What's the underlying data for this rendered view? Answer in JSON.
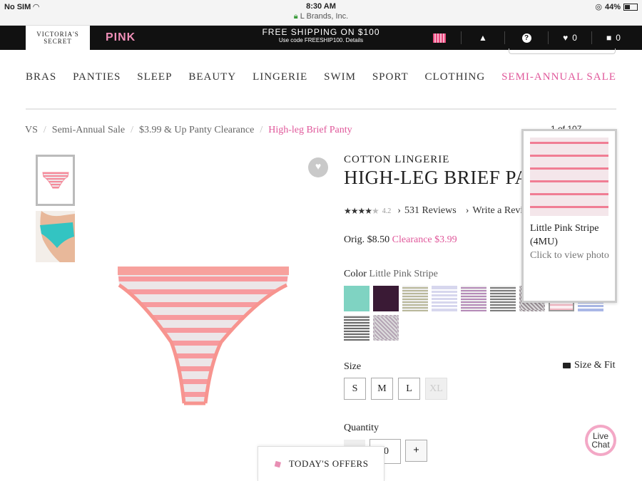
{
  "status_bar": {
    "carrier": "No SIM",
    "time": "8:30 AM",
    "site": "L Brands, Inc.",
    "battery": "44%"
  },
  "top_bar": {
    "brand_vs_line1": "VICTORIA'S",
    "brand_vs_line2": "SECRET",
    "brand_pink": "PINK",
    "shipping_line1": "FREE SHIPPING ON $100",
    "shipping_line2": "Use code FREESHIP100. Details",
    "favorites_count": "0",
    "bag_count": "0"
  },
  "nav": {
    "items": [
      "BRAS",
      "PANTIES",
      "SLEEP",
      "BEAUTY",
      "LINGERIE",
      "SWIM",
      "SPORT",
      "CLOTHING",
      "SEMI-ANNUAL SALE"
    ]
  },
  "breadcrumb": [
    "VS",
    "Semi-Annual Sale",
    "$3.99 & Up Panty Clearance",
    "High-leg Brief Panty"
  ],
  "product": {
    "collection": "COTTON LINGERIE",
    "title": "HIGH-LEG BRIEF PANTY",
    "rating_value": "4.2",
    "reviews_link": "531 Reviews",
    "write_link": "Write a Review",
    "orig_price": "Orig. $8.50",
    "clearance_price": "Clearance $3.99",
    "color_label": "Color",
    "color_value": "Little Pink Stripe",
    "size_label": "Size",
    "size_fit": "Size & Fit",
    "sizes": [
      "S",
      "M",
      "L",
      "XL"
    ],
    "quantity_label": "Quantity",
    "quantity_value": "0"
  },
  "swatch_colors": [
    "#7fd3c2",
    "#3a1a35",
    "#b9b89b",
    "#d7d7ee",
    "#b58bb8",
    "#7c7c7c",
    "#9a8f96",
    "#f6d6dc",
    "#a9b7e6",
    "#6a6a6a",
    "#b5a5b5"
  ],
  "popup": {
    "name": "Little Pink Stripe (4MU)",
    "hint": "Click to view photo"
  },
  "peek_text": "1 of 107",
  "offers_label": "TODAY'S OFFERS",
  "chat_label_1": "Live",
  "chat_label_2": "Chat",
  "colors": {
    "accent_pink": "#e0579a",
    "topbar": "#111111"
  }
}
